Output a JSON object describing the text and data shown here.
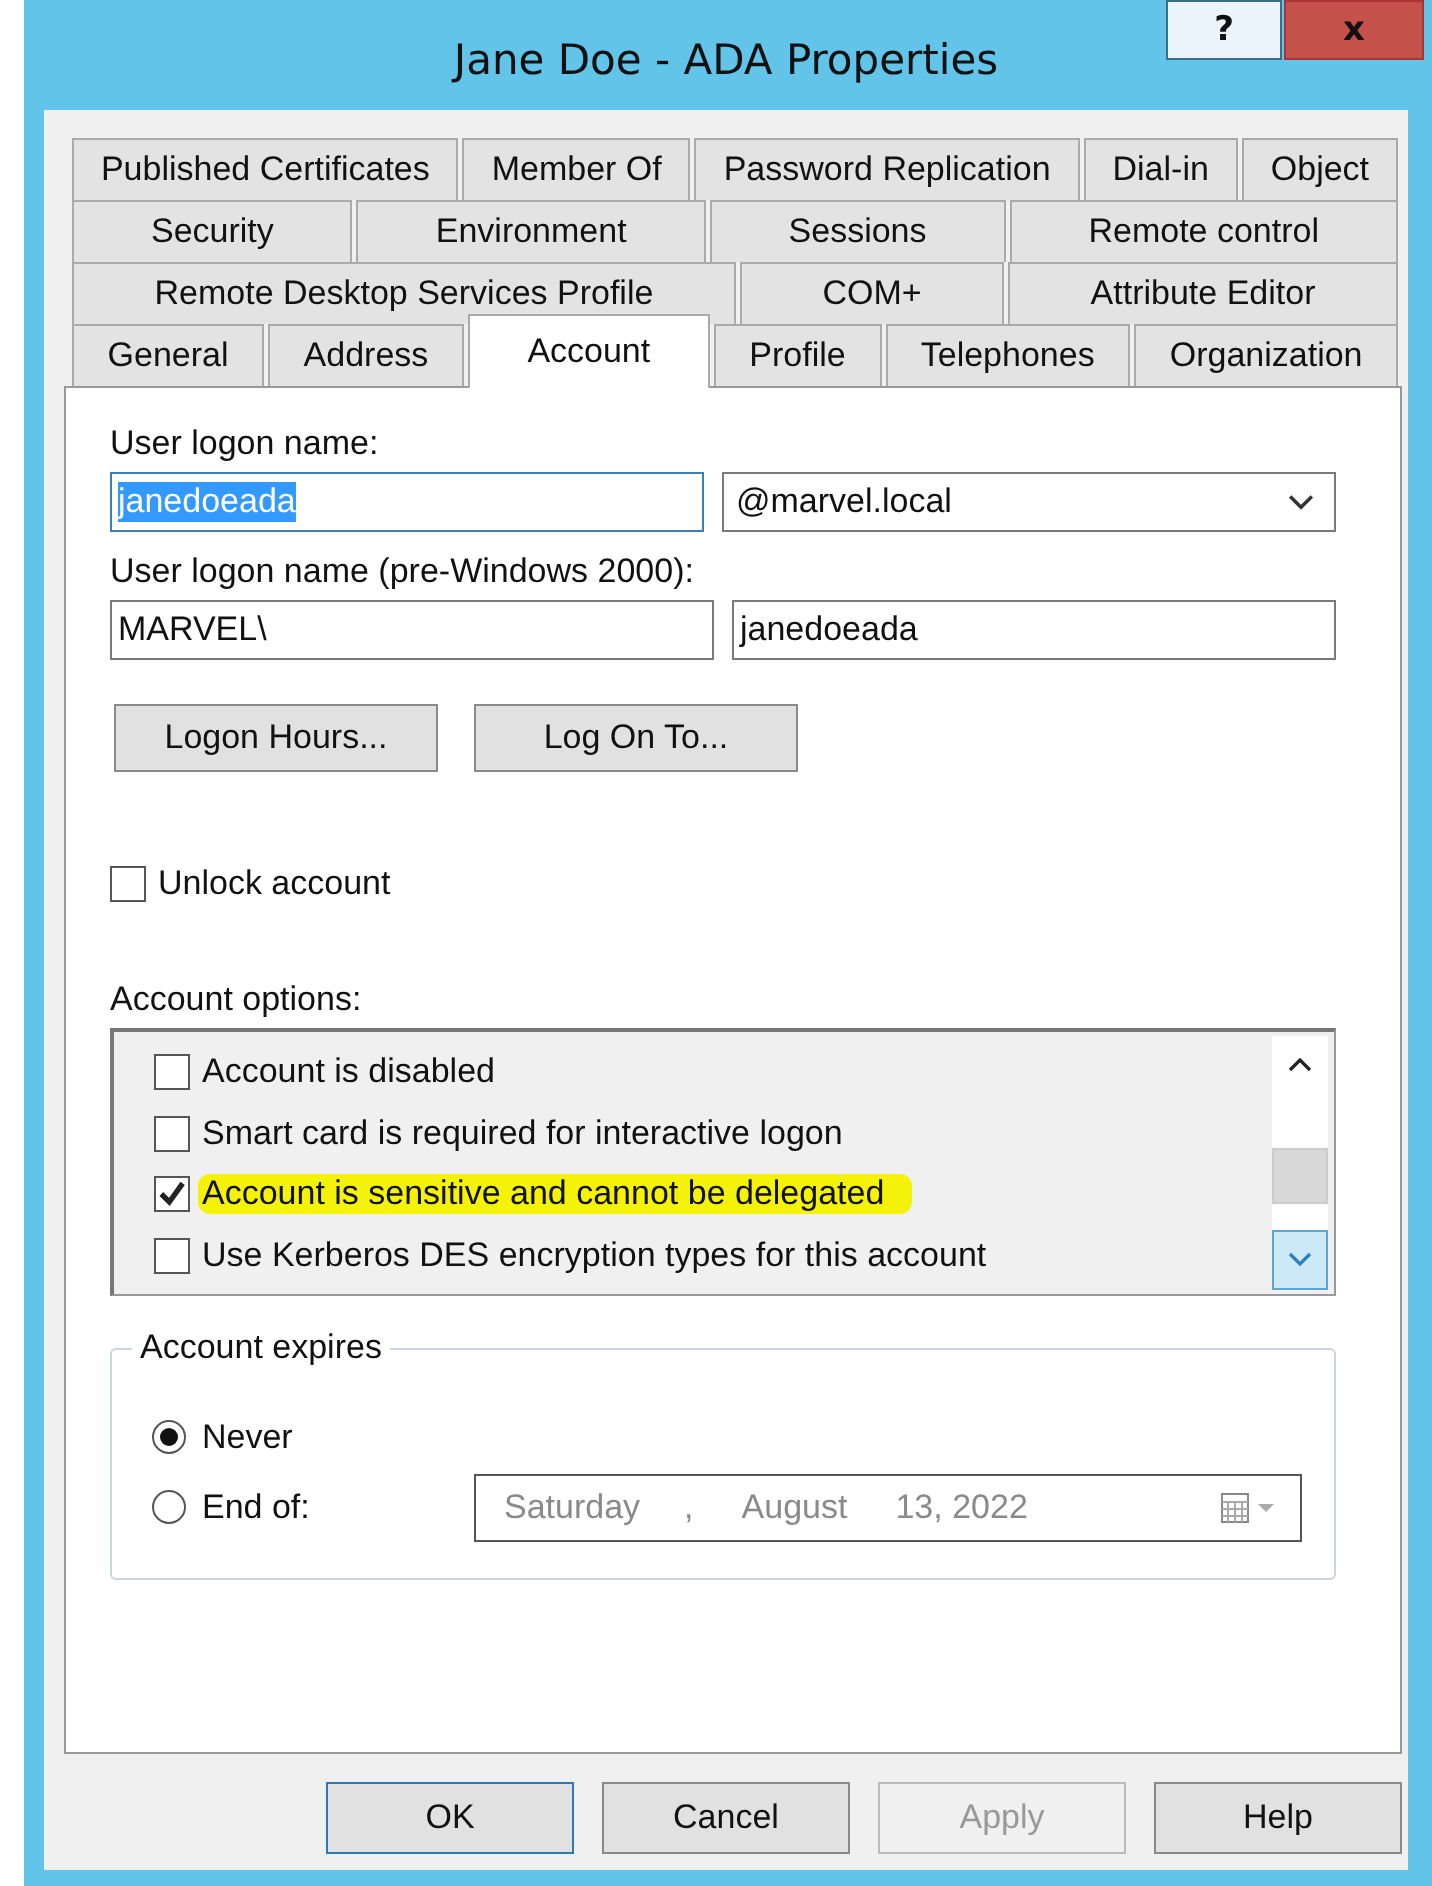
{
  "window": {
    "title": "Jane Doe - ADA Properties",
    "help_button": "?",
    "close_button": "x"
  },
  "tab_rows": [
    [
      {
        "label": "Published Certificates",
        "selected": false
      },
      {
        "label": "Member Of",
        "selected": false
      },
      {
        "label": "Password Replication",
        "selected": false
      },
      {
        "label": "Dial-in",
        "selected": false
      },
      {
        "label": "Object",
        "selected": false
      }
    ],
    [
      {
        "label": "Security",
        "selected": false
      },
      {
        "label": "Environment",
        "selected": false
      },
      {
        "label": "Sessions",
        "selected": false
      },
      {
        "label": "Remote control",
        "selected": false
      }
    ],
    [
      {
        "label": "Remote Desktop Services Profile",
        "selected": false
      },
      {
        "label": "COM+",
        "selected": false
      },
      {
        "label": "Attribute Editor",
        "selected": false
      }
    ],
    [
      {
        "label": "General",
        "selected": false
      },
      {
        "label": "Address",
        "selected": false
      },
      {
        "label": "Account",
        "selected": true
      },
      {
        "label": "Profile",
        "selected": false
      },
      {
        "label": "Telephones",
        "selected": false
      },
      {
        "label": "Organization",
        "selected": false
      }
    ]
  ],
  "logon_name": {
    "label": "User logon name:",
    "value": "janedoeada",
    "text_selected": true,
    "domain": "@marvel.local"
  },
  "pre2000": {
    "label": "User logon name (pre-Windows 2000):",
    "domain": "MARVEL\\",
    "value": "janedoeada"
  },
  "logon_buttons": [
    "Logon Hours...",
    "Log On To..."
  ],
  "unlock": {
    "label": "Unlock account",
    "checked": false
  },
  "account_options": {
    "label": "Account options:",
    "items": [
      {
        "label": "Account is disabled",
        "checked": false,
        "highlighted": false
      },
      {
        "label": "Smart card is required for interactive logon",
        "checked": false,
        "highlighted": false
      },
      {
        "label": "Account is sensitive and cannot be delegated",
        "checked": true,
        "highlighted": true
      },
      {
        "label": "Use Kerberos DES encryption types for this account",
        "checked": false,
        "highlighted": false
      }
    ]
  },
  "account_expires": {
    "label": "Account expires",
    "options": [
      {
        "label": "Never",
        "selected": true
      },
      {
        "label": "End of:",
        "selected": false
      }
    ],
    "date": {
      "parts": [
        "Saturday",
        ",",
        "August",
        "13, 2022"
      ],
      "disabled": true
    }
  },
  "buttons": [
    {
      "label": "OK",
      "default": true,
      "disabled": false
    },
    {
      "label": "Cancel",
      "default": false,
      "disabled": false
    },
    {
      "label": "Apply",
      "default": false,
      "disabled": true
    },
    {
      "label": "Help",
      "default": false,
      "disabled": false
    }
  ]
}
